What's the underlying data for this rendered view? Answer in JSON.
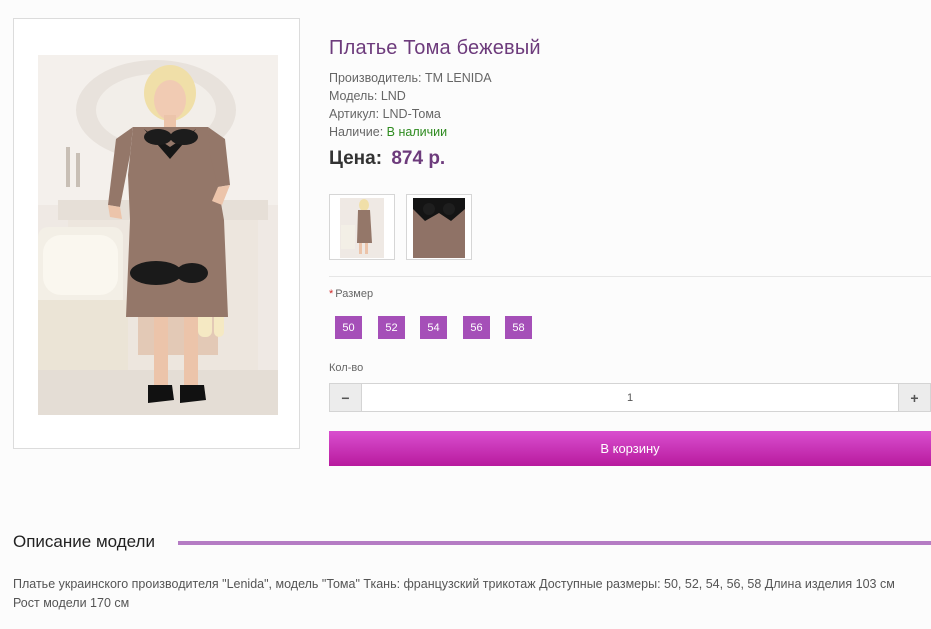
{
  "product": {
    "title": "Платье Тома бежевый",
    "manufacturer_label": "Производитель:",
    "manufacturer": "TM LENIDA",
    "model_label": "Модель:",
    "model": "LND",
    "sku_label": "Артикул:",
    "sku": "LND-Тома",
    "availability_label": "Наличие:",
    "availability": "В наличии",
    "price_label": "Цена:",
    "price": "874 р."
  },
  "options": {
    "size_label": "Размер",
    "sizes": [
      "50",
      "52",
      "54",
      "56",
      "58"
    ],
    "qty_label": "Кол-во",
    "qty_value": "1",
    "qty_minus": "−",
    "qty_plus": "+"
  },
  "cart_button": "В корзину",
  "description": {
    "title": "Описание модели",
    "text": "Платье украинского производителя \"Lenida\", модель \"Тома\" Ткань: французский трикотаж Доступные размеры: 50, 52, 54, 56, 58 Длина изделия 103 см Рост модели 170 см"
  },
  "colors": {
    "accent": "#a54fb8",
    "title": "#6d3b7c",
    "cart": "#c42eb0",
    "in_stock": "#2e8b1f"
  }
}
